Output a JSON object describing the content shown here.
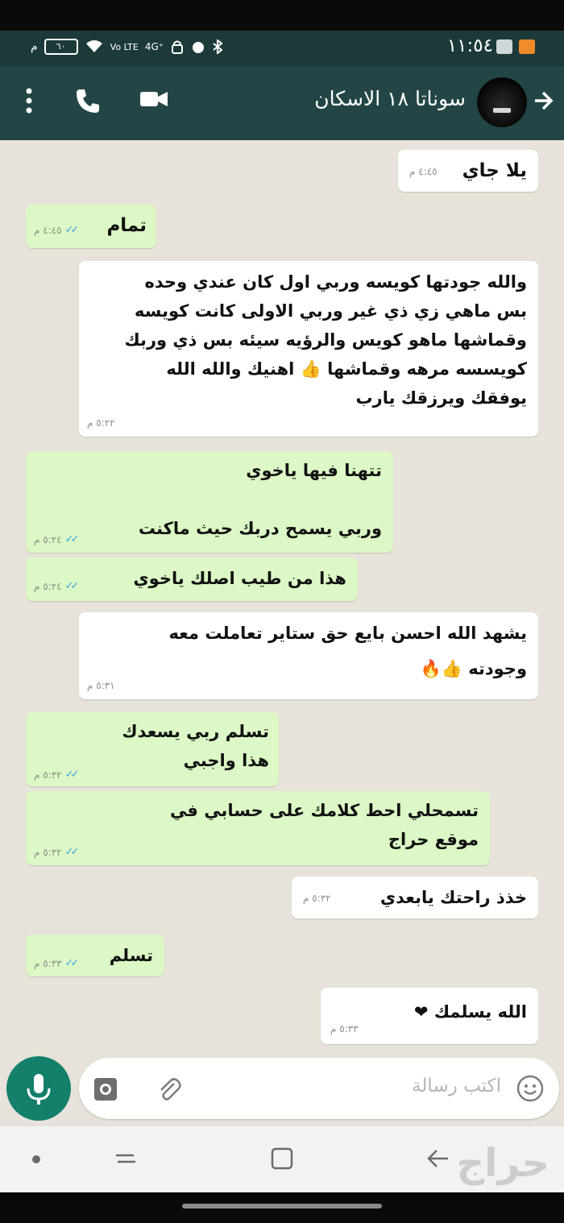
{
  "status_bar": {
    "time": "١١:٥٤",
    "battery": "٦٠",
    "network": "4G⁺",
    "signal_text": "Vo LTE"
  },
  "header": {
    "contact_name": "سوناتا ١٨ الاسكان"
  },
  "messages": [
    {
      "dir": "in",
      "text": "يلا جاي",
      "time": "٤:٤٥ م"
    },
    {
      "dir": "out",
      "text": "تمام",
      "time": "٤:٤٥ م"
    },
    {
      "dir": "in",
      "text": "والله جودتها كويسه وربي اول كان عندي وحده\nبس ماهي زي ذي غير وربي الاولى كانت كويسه\nوقماشها ماهو كويس والرؤيه سيئه بس ذي وربك\nكويسسه مرهه وقماشها 👍 اهنيك والله الله\nيوفقك ويرزقك يارب",
      "time": "٥:٢٢ م"
    },
    {
      "dir": "out",
      "text": "تتهنا فيها ياخوي\n\nوربي يسمح دربك حيث ماكنت",
      "time": "٥:٢٤ م"
    },
    {
      "dir": "out",
      "text": "هذا من طيب اصلك ياخوي",
      "time": "٥:٢٤ م"
    },
    {
      "dir": "in",
      "text": "يشهد الله احسن بايع حق ستاير تعاملت معه\nوجودته 👍🔥",
      "time": "٥:٣١ م"
    },
    {
      "dir": "out",
      "text": "تسلم ربي يسعدك\nهذا واجبي",
      "time": "٥:٣٢ م"
    },
    {
      "dir": "out",
      "text": "تسمحلي احط كلامك على حسابي في\nموقع حراج",
      "time": "٥:٣٢ م"
    },
    {
      "dir": "in",
      "text": "خذذ راحتك يابعدي",
      "time": "٥:٣٢ م"
    },
    {
      "dir": "out",
      "text": "تسلم",
      "time": "٥:٣٣ م"
    },
    {
      "dir": "in",
      "text": "الله يسلمك ❤",
      "time": "٥:٣٣ م"
    }
  ],
  "input": {
    "placeholder": "اكتب رسالة"
  },
  "watermark": "حراج",
  "colors": {
    "header": "#234545",
    "chat_bg": "#e8e3da",
    "outgoing": "#dcf8c6",
    "incoming": "#ffffff",
    "read_ticks": "#3ca6e8",
    "mic_button": "#14806c"
  }
}
